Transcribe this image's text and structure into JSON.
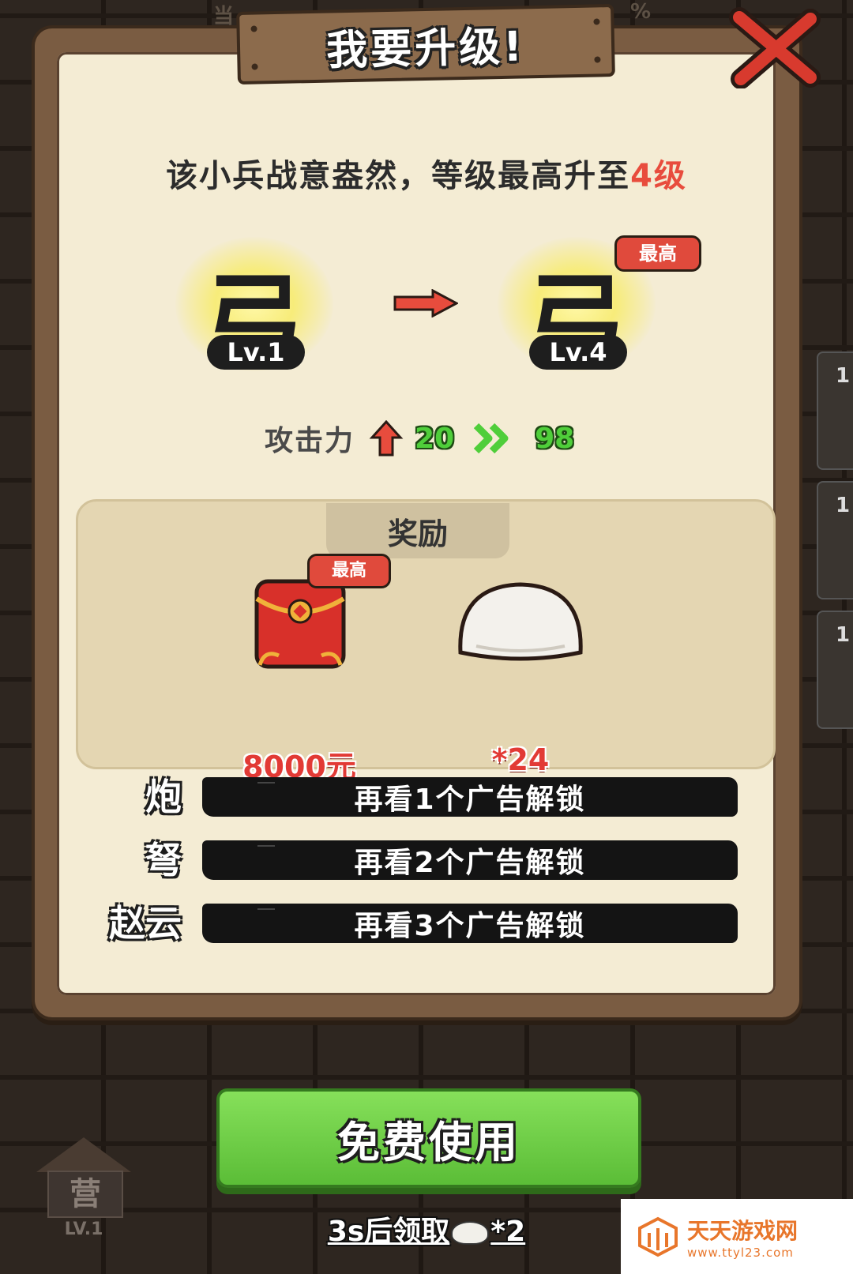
{
  "background": {
    "top_text_left": "当",
    "top_text_right": "%"
  },
  "side_tiles": [
    "1",
    "1",
    "1"
  ],
  "dialog": {
    "title": "我要升级!",
    "headline_prefix": "该小兵战意盎然，等级最高升至",
    "headline_level": "4级",
    "from_unit": {
      "glyph": "弓",
      "level": "Lv.1"
    },
    "to_unit": {
      "glyph": "弓",
      "level": "Lv.4",
      "badge": "最高"
    },
    "stat": {
      "label": "攻击力",
      "from": "20",
      "to": "98"
    },
    "rewards": {
      "title": "奖励",
      "items": [
        {
          "icon": "red-envelope-icon",
          "badge": "最高",
          "value": "8000元"
        },
        {
          "icon": "steamed-bun-icon",
          "value": "*24"
        }
      ]
    },
    "unlocks": [
      {
        "name": "炮",
        "action": "再看1个广告解锁"
      },
      {
        "name": "弩",
        "action": "再看2个广告解锁"
      },
      {
        "name": "赵云",
        "action": "再看3个广告解锁"
      }
    ]
  },
  "free_button": "免费使用",
  "claim": {
    "text": "3s后领取",
    "count": "*2"
  },
  "barracks": {
    "label": "营",
    "level": "LV.1"
  },
  "watermark": {
    "main": "天天游戏网",
    "sub": "www.ttyl23.com"
  },
  "colors": {
    "accent_red": "#e84c3d",
    "stat_green": "#4fce3a",
    "button_green": "#5bbd37",
    "panel_bg": "#f4ecd4"
  }
}
